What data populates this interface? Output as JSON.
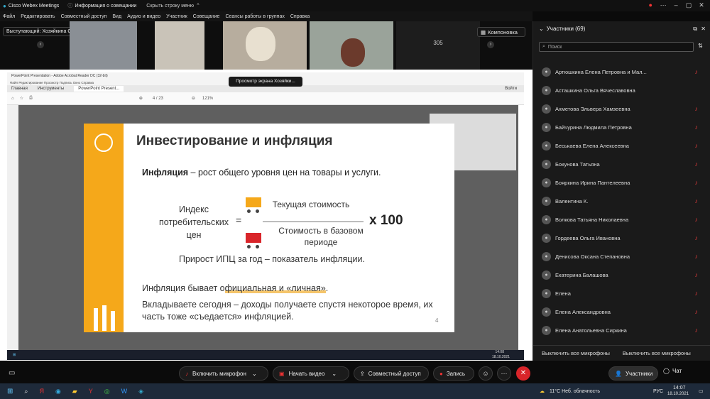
{
  "titlebar": {
    "app": "Cisco Webex Meetings",
    "meeting_info": "Информация о совещании",
    "hide_menu": "Скрыть строку меню"
  },
  "menu": [
    "Файл",
    "Редактировать",
    "Совместный доступ",
    "Вид",
    "Аудио и видео",
    "Участник",
    "Совещание",
    "Сеансы работы в группах",
    "Справка"
  ],
  "speaker": "Выступающий: Хозяйкина Ольга, Отделение-НБ Ре...",
  "layout_label": "Компоновка",
  "video_count": "305",
  "view_screen": "Просмотр экрана Хозяйки...",
  "pdf": {
    "title": "PowerPoint Presentation - Adobe Acrobat Reader DC (32-bit)",
    "menu": "Файл  Редактирование  Просмотр  Подпись  Окно  Справка",
    "tabs": [
      "Главная",
      "Инструменты",
      "PowerPoint Present..."
    ],
    "signin": "Войти",
    "page": "4 / 23",
    "zoom": "121%"
  },
  "slide": {
    "title": "Инвестирование и инфляция",
    "def_bold": "Инфляция",
    "def_rest": " – рост общего уровня цен на товары и услуги.",
    "index_label": "Индекс потребительских цен",
    "eq": "=",
    "current": "Текущая стоимость",
    "base": "Стоимость в базовом периоде",
    "mult": "x 100",
    "growth": "Прирост ИПЦ за год – показатель инфляции.",
    "line1_a": "Инфляция бывает о",
    "line1_b": "фициальная и «личная»",
    "line1_c": ".",
    "line2": "Вкладываете сегодня – доходы получаете спустя некоторое время, их часть тоже «съедается» инфляцией.",
    "page_num": "4"
  },
  "taskwin_time": "14:08",
  "taskwin_date": "18.10.2021",
  "panel": {
    "title": "Участники (69)",
    "search_placeholder": "Поиск",
    "participants": [
      "Артюшкина Елена Петровна и Мал...",
      "Асташкина Ольга Вячеславовна",
      "Ахметова Эльвера Хамзеевна",
      "Байчурина Людмила Петровна",
      "Беськаева Елена Алексеевна",
      "Бокунова Татьяна",
      "Бояркина Ирина Пантелеевна",
      "Валентина К.",
      "Волкова Татьяна Николаевна",
      "Гордеева Ольга Ивановна",
      "Денисова Оксана Степановна",
      "Екатерина Балашова",
      "Елена",
      "Елена Александровна",
      "Елена Анатольевна Сиркина"
    ],
    "mute_all": "Выключить все микрофоны",
    "mute_all2": "Выключить все микрофоны"
  },
  "controls": {
    "mic": "Включить микрофон",
    "video": "Начать видео",
    "share": "Совместный доступ",
    "record": "Запись",
    "participants": "Участники",
    "chat": "Чат"
  },
  "taskbar": {
    "weather": "11°C  Неб. облачность",
    "lang": "РУС",
    "time": "14:07",
    "date": "18.10.2021"
  },
  "colors": {
    "accent": "#f5a81a",
    "red": "#d9252a",
    "panel": "#1a1a1a"
  }
}
